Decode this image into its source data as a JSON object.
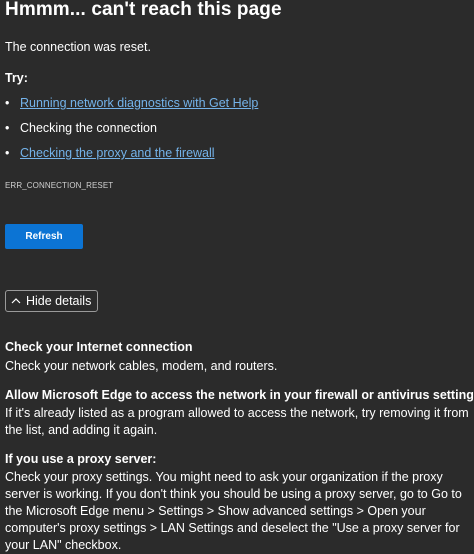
{
  "title": "Hmmm... can't reach this page",
  "message": "The connection was reset.",
  "try_label": "Try:",
  "suggestions": [
    {
      "label": "Running network diagnostics with Get Help",
      "link": true
    },
    {
      "label": "Checking the connection",
      "link": false
    },
    {
      "label": "Checking the proxy and the firewall",
      "link": true
    }
  ],
  "bullet": "•",
  "error_code": "ERR_CONNECTION_RESET",
  "refresh_label": "Refresh",
  "details_toggle_label": "Hide details",
  "details": [
    {
      "heading": "Check your Internet connection",
      "body": "Check your network cables, modem, and routers."
    },
    {
      "heading": "Allow Microsoft Edge to access the network in your firewall or antivirus settings.",
      "body": "If it's already listed as a program allowed to access the network, try removing it from the list, and adding it again."
    },
    {
      "heading": "If you use a proxy server:",
      "body": "Check your proxy settings. You might need to ask your organization if the proxy server is working. If you don't think you should be using a proxy server, go to Go to the Microsoft Edge menu > Settings > Show advanced settings > Open your computer's proxy settings > LAN Settings and deselect the \"Use a proxy server for your LAN\" checkbox."
    }
  ],
  "colors": {
    "background": "#2b2b2b",
    "link": "#74b3ea",
    "button": "#0c74d4"
  }
}
